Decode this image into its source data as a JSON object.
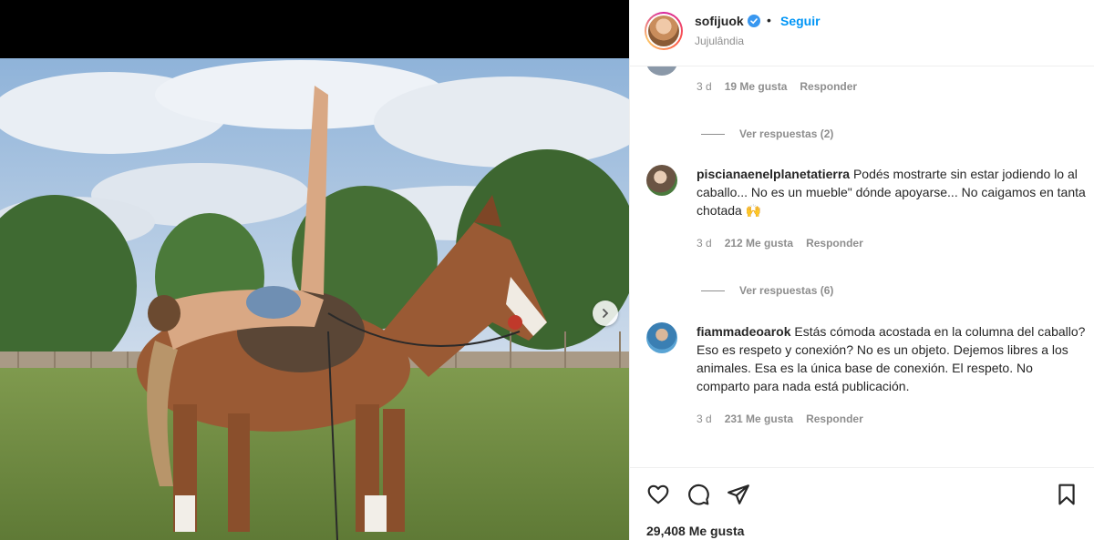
{
  "header": {
    "username": "sofijuok",
    "separator": "•",
    "follow_label": "Seguir",
    "location": "Jujulândia"
  },
  "comments": [
    {
      "partial": true,
      "time": "3 d",
      "likes": "19 Me gusta",
      "reply": "Responder",
      "view_replies": "Ver respuestas (2)"
    },
    {
      "username": "piscianaenelplanetatierra",
      "text": "Podés mostrarte sin estar jodiendo lo al caballo... No es un mueble\" dónde apoyarse... No caigamos en tanta chotada 🙌",
      "time": "3 d",
      "likes": "212 Me gusta",
      "reply": "Responder",
      "view_replies": "Ver respuestas (6)"
    },
    {
      "username": "fiammadeoarok",
      "text": "Estás cómoda acostada en la columna del caballo? Eso es respeto y conexión? No es un objeto. Dejemos libres a los animales. Esa es la única base de conexión. El respeto. No comparto para nada está publicación.",
      "time": "3 d",
      "likes": "231 Me gusta",
      "reply": "Responder"
    }
  ],
  "footer": {
    "likes_total": "29,408 Me gusta"
  },
  "colors": {
    "accent": "#0095f6",
    "muted": "#8e8e8e",
    "text": "#262626"
  },
  "icons": [
    "heart-icon",
    "comment-icon",
    "share-icon",
    "bookmark-icon",
    "chevron-right-icon",
    "verified-badge-icon"
  ]
}
